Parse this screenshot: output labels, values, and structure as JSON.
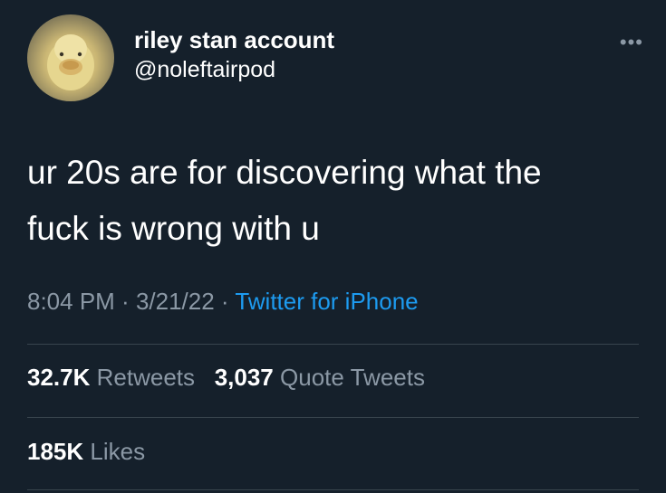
{
  "author": {
    "display_name": "riley stan account",
    "handle": "@noleftairpod",
    "avatar_icon": "duckling-avatar"
  },
  "menu_icon": "more-horizontal-icon",
  "menu_glyph": "•••",
  "tweet": {
    "line1": "ur 20s are for discovering what the",
    "line2": "fuck is wrong with u"
  },
  "meta": {
    "time": "8:04 PM",
    "sep1": " · ",
    "date": "3/21/22",
    "sep2": " · ",
    "source": "Twitter for iPhone"
  },
  "stats": {
    "retweets_count": "32.7K",
    "retweets_label": "Retweets",
    "quotes_count": "3,037",
    "quotes_label": "Quote Tweets",
    "likes_count": "185K",
    "likes_label": "Likes"
  },
  "colors": {
    "background": "#15202b",
    "text": "#ffffff",
    "secondary": "#8b98a5",
    "link": "#1d9bf0",
    "divider": "#38444d"
  }
}
